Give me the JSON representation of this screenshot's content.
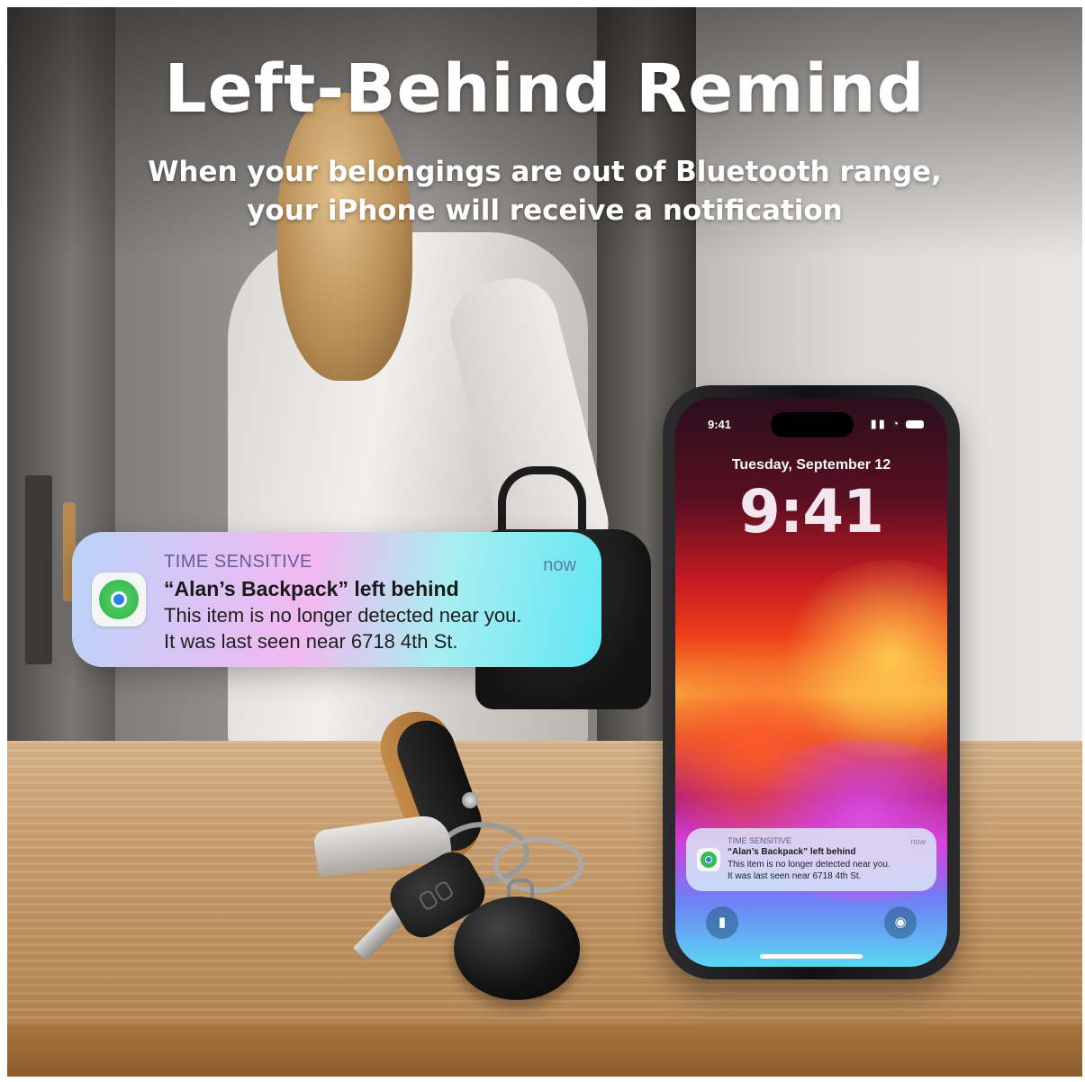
{
  "headline": "Left-Behind Remind",
  "subline": {
    "line1": "When your belongings are out of Bluetooth range,",
    "line2": "your iPhone will receive a notification"
  },
  "notification": {
    "tag": "TIME SENSITIVE",
    "time": "now",
    "title": "“Alan’s Backpack” left behind",
    "line1": "This item is no longer detected near you.",
    "line2": "It was last seen near 6718 4th St.",
    "app_icon": "find-my-icon"
  },
  "phone": {
    "status_time": "9:41",
    "status_icons": "signal-wifi-battery",
    "lock_date": "Tuesday, September 12",
    "lock_time": "9:41",
    "quick_actions": [
      "flashlight-icon",
      "camera-icon"
    ]
  },
  "colors": {
    "notification_gradient_start": "#b9d3f7",
    "notification_gradient_mid": "#f2b9f0",
    "notification_gradient_end": "#5fe6f4",
    "find_my_green": "#28b448",
    "find_my_blue": "#2b7de9"
  }
}
